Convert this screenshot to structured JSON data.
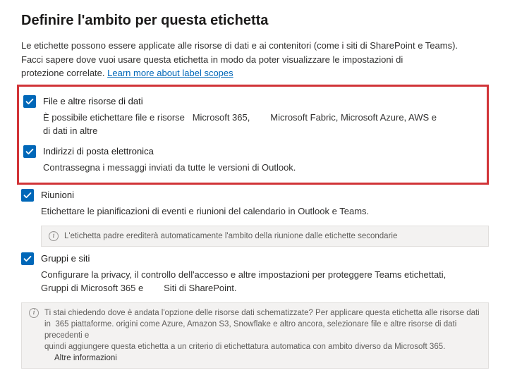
{
  "page": {
    "title": "Definire l'ambito per questa etichetta",
    "intro_line1": "Le etichette possono essere applicate alle risorse di dati e ai contenitori (come i siti di SharePoint e Teams).",
    "intro_line2_a": "Facci sapere dove vuoi usare questa etichetta in modo da poter visualizzare le impostazioni di",
    "intro_line2_b": "protezione correlate.",
    "learn_more_link": "Learn more about label scopes"
  },
  "options": {
    "files": {
      "label": "File e altre risorse di dati",
      "desc_a": "È possibile etichettare file e risorse",
      "desc_b": "Microsoft 365,",
      "desc_c": "Microsoft Fabric, Microsoft Azure, AWS e",
      "desc_d": "di dati in altre"
    },
    "emails": {
      "label": "Indirizzi di posta elettronica",
      "desc": "Contrassegna i messaggi inviati da tutte le versioni di Outlook."
    },
    "meetings": {
      "label": "Riunioni",
      "desc": "Etichettare le pianificazioni di eventi e riunioni del calendario in Outlook e Teams.",
      "info": "L'etichetta padre erediterà automaticamente l'ambito della riunione dalle etichette secondarie"
    },
    "groups": {
      "label": "Gruppi e siti",
      "desc_a": "Configurare la privacy, il controllo dell'accesso e altre impostazioni per proteggere Teams etichettati,",
      "desc_b": "Gruppi di Microsoft 365 e",
      "desc_c": "Siti di SharePoint."
    }
  },
  "footer_info": {
    "line1_a": "Ti stai chiedendo dove è andata l'opzione delle risorse dati schematizzate? Per applicare questa etichetta alle risorse dati in",
    "line1_b": "365",
    "line2_a": "piattaforme. origini come Azure, Amazon S3, Snowflake e altro ancora, selezionare file e altre risorse di dati precedenti e",
    "line3": "quindi aggiungere questa etichetta a un criterio di etichettatura automatica con ambito diverso da Microsoft 365.",
    "more": "Altre informazioni"
  }
}
